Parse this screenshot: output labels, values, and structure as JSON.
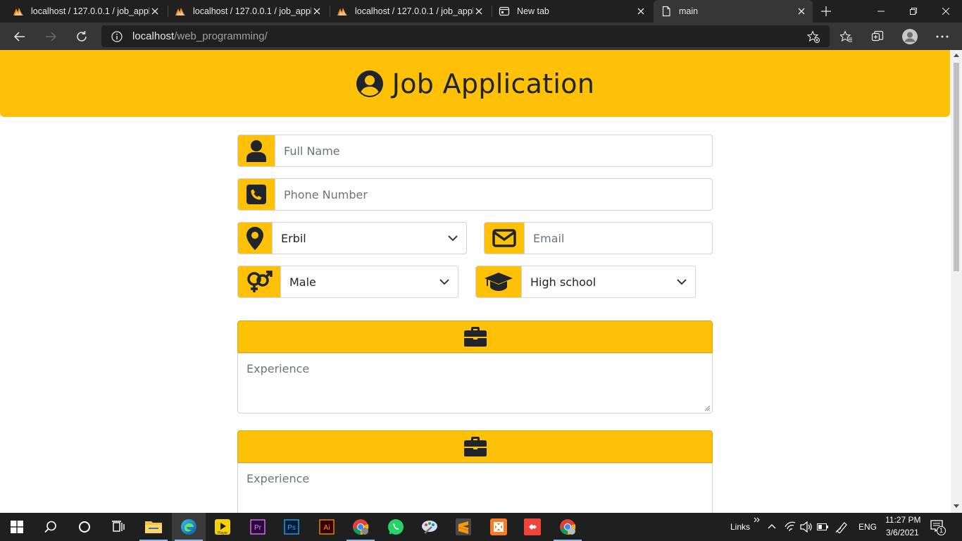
{
  "browser": {
    "tabs": [
      {
        "title": "localhost / 127.0.0.1 / job_appli",
        "active": false
      },
      {
        "title": "localhost / 127.0.0.1 / job_appli",
        "active": false
      },
      {
        "title": "localhost / 127.0.0.1 / job_appli",
        "active": false
      },
      {
        "title": "New tab",
        "active": false
      },
      {
        "title": "main",
        "active": true
      }
    ],
    "url_host": "localhost",
    "url_path": "/web_programming/"
  },
  "page": {
    "title": "Job Application",
    "full_name_placeholder": "Full Name",
    "phone_placeholder": "Phone Number",
    "city_value": "Erbil",
    "email_placeholder": "Email",
    "gender_value": "Male",
    "education_value": "High school",
    "experience_blocks": [
      {
        "placeholder": "Experience"
      },
      {
        "placeholder": "Experience"
      }
    ],
    "accent_color": "#ffc107"
  },
  "taskbar": {
    "links_label": "Links",
    "language": "ENG",
    "time": "11:27 PM",
    "date": "3/6/2021",
    "notification_count": "1",
    "apps": [
      "file-explorer",
      "edge",
      "player",
      "premiere-pro",
      "photoshop",
      "illustrator",
      "chrome",
      "whatsapp",
      "paint",
      "sublime-text",
      "xampp",
      "anydesk",
      "chrome-profile"
    ]
  }
}
